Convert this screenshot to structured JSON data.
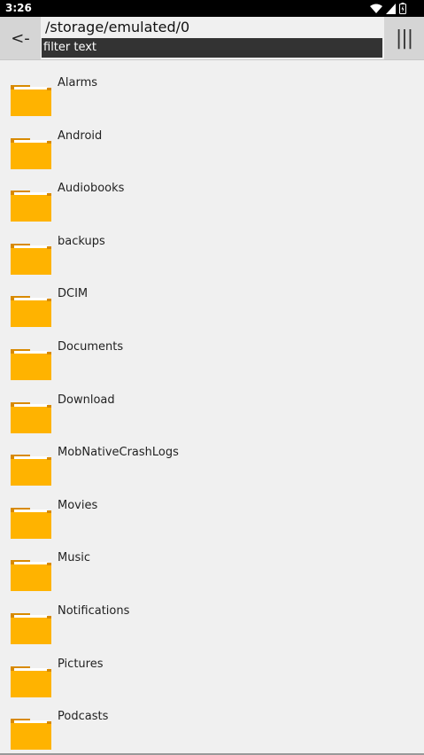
{
  "statusbar": {
    "time": "3:26",
    "icons": [
      "wifi-icon",
      "signal-icon",
      "battery-icon"
    ]
  },
  "toolbar": {
    "back_label": "<-",
    "path": "/storage/emulated/0",
    "filter_placeholder": "filter text",
    "menu_label": "|||"
  },
  "colors": {
    "folder_body": "#ffb300",
    "folder_tab": "#d88a00",
    "background": "#f0f0f0"
  },
  "files": [
    {
      "name": "Alarms",
      "icon": "folder-icon"
    },
    {
      "name": "Android",
      "icon": "folder-icon"
    },
    {
      "name": "Audiobooks",
      "icon": "folder-icon"
    },
    {
      "name": "backups",
      "icon": "folder-icon"
    },
    {
      "name": "DCIM",
      "icon": "folder-icon"
    },
    {
      "name": "Documents",
      "icon": "folder-icon"
    },
    {
      "name": "Download",
      "icon": "folder-icon"
    },
    {
      "name": "MobNativeCrashLogs",
      "icon": "folder-icon"
    },
    {
      "name": "Movies",
      "icon": "folder-icon"
    },
    {
      "name": "Music",
      "icon": "folder-icon"
    },
    {
      "name": "Notifications",
      "icon": "folder-icon"
    },
    {
      "name": "Pictures",
      "icon": "folder-icon"
    },
    {
      "name": "Podcasts",
      "icon": "folder-icon"
    }
  ]
}
